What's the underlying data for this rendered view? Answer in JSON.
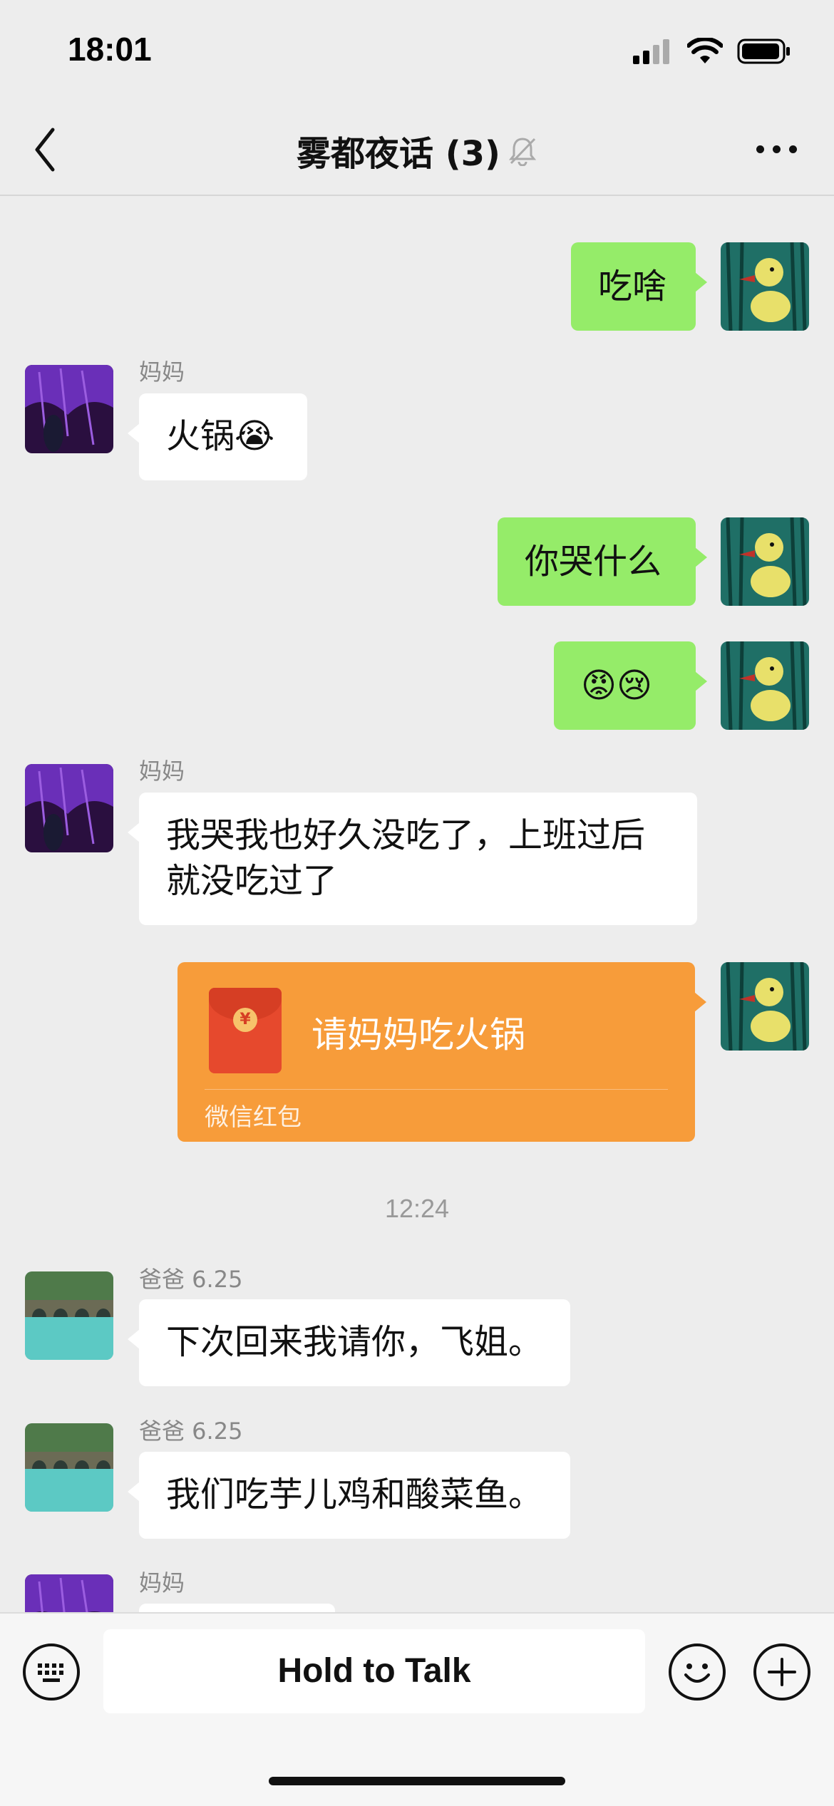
{
  "status_bar": {
    "time": "18:01"
  },
  "header": {
    "title": "雾都夜话 (3)",
    "icons": [
      "back-chevron-icon",
      "mute-bell-icon",
      "more-icon"
    ]
  },
  "colors": {
    "my_bubble": "#95ec69",
    "their_bubble": "#ffffff",
    "red_packet": "#f79c3a",
    "background": "#ededed"
  },
  "messages": [
    {
      "from": "me",
      "text": "吃啥"
    },
    {
      "from": "妈妈",
      "sender": "妈妈",
      "text": "火锅😭"
    },
    {
      "from": "me",
      "text": "你哭什么"
    },
    {
      "from": "me",
      "text": "😡😢"
    },
    {
      "from": "妈妈",
      "sender": "妈妈",
      "text": "我哭我也好久没吃了，上班过后就没吃过了"
    },
    {
      "from": "me",
      "type": "red_packet",
      "text": "请妈妈吃火锅",
      "label": "微信红包"
    },
    {
      "type": "timestamp",
      "text": "12:24"
    },
    {
      "from": "爸爸",
      "sender": "爸爸 6.25",
      "text": "下次回来我请你，飞姐。"
    },
    {
      "from": "爸爸",
      "sender": "爸爸 6.25",
      "text": "我们吃芋儿鸡和酸菜鱼。"
    },
    {
      "from": "妈妈",
      "sender": "妈妈",
      "text": ""
    }
  ],
  "input_bar": {
    "hold_to_talk": "Hold to Talk",
    "icons": [
      "keyboard-icon",
      "emoji-icon",
      "plus-icon"
    ]
  },
  "red_packet_symbol": "¥"
}
